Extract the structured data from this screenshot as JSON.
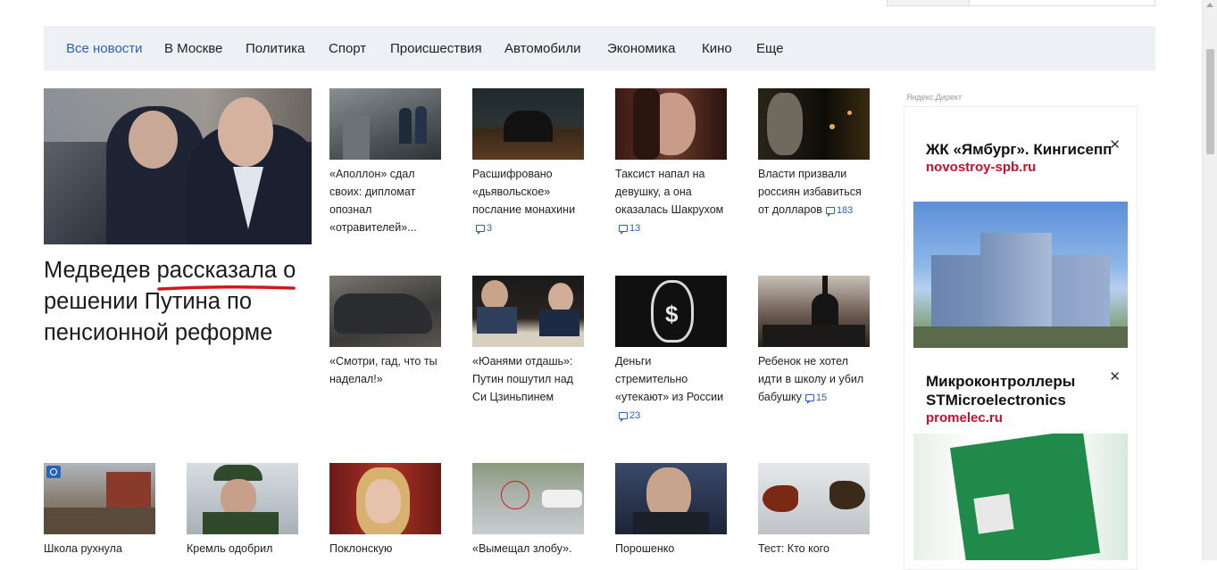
{
  "nav": {
    "items": [
      "Все новости",
      "В Москве",
      "Политика",
      "Спорт",
      "Происшествия",
      "Автомобили",
      "Экономика",
      "Кино",
      "Еще"
    ]
  },
  "hero": {
    "title": "Медведев рассказала о решении Путина по пенсионной реформе"
  },
  "cards": [
    {
      "title": "«Аполлон» сдал своих: дипломат опознал «отравителей»...",
      "comments": ""
    },
    {
      "title": "Расшифровано «дьявольское» послание монахини",
      "comments": "3"
    },
    {
      "title": "Таксист напал на девушку, а она оказалась Шакрухом",
      "comments": "13"
    },
    {
      "title": "Власти призвали россиян избавиться от долларов",
      "comments": "183"
    },
    {
      "title": "«Смотри, гад, что ты наделал!»",
      "comments": ""
    },
    {
      "title": "«Юанями отдашь»: Путин пошутил над Си Цзиньпинем",
      "comments": ""
    },
    {
      "title": "Деньги стремительно «утекают» из России",
      "comments": "23"
    },
    {
      "title": "Ребенок не хотел идти в школу и убил бабушку",
      "comments": "15"
    },
    {
      "title": "Школа рухнула",
      "comments": ""
    },
    {
      "title": "Кремль одобрил",
      "comments": ""
    },
    {
      "title": "Поклонскую",
      "comments": ""
    },
    {
      "title": "«Вымещал злобу».",
      "comments": ""
    },
    {
      "title": "Порошенко",
      "comments": ""
    },
    {
      "title": "Тест: Кто кого",
      "comments": ""
    }
  ],
  "direct": {
    "label": "Яндекс.Директ",
    "ads": [
      {
        "title": "ЖК «Ямбург». Кингисепп",
        "domain": "novostroy-spb.ru",
        "close": "✕"
      },
      {
        "title": "Микроконтроллеры STMicroelectronics",
        "domain": "promelec.ru",
        "close": "✕"
      }
    ]
  },
  "colors": {
    "accent": "#2a62b8",
    "nav_bg": "#edf0f4",
    "ad_domain": "#c8102e",
    "underline": "#d0191d"
  }
}
